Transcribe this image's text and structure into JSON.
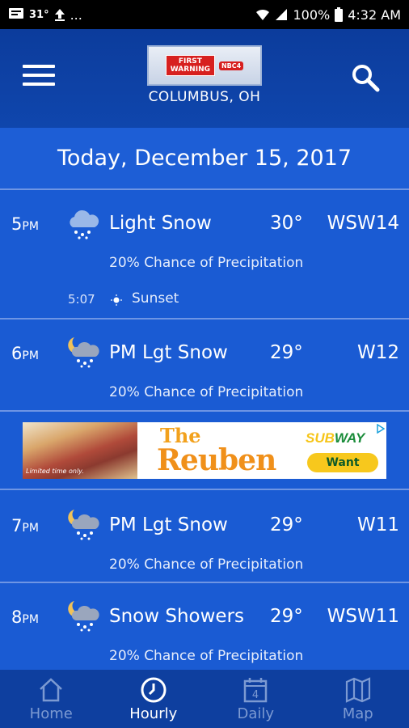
{
  "status_bar": {
    "temp": "31°",
    "overflow": "...",
    "battery": "100%",
    "time": "4:32 AM"
  },
  "header": {
    "logo_line1": "FIRST",
    "logo_line2": "WARNING",
    "location": "COLUMBUS, OH"
  },
  "date_label": "Today, December 15, 2017",
  "hours": [
    {
      "hour": "5",
      "period": "PM",
      "condition": "Light Snow",
      "temp": "30°",
      "wind": "WSW14",
      "precip": "20% Chance of Precipitation",
      "icon": "snow-cloud-icon"
    },
    {
      "hour": "6",
      "period": "PM",
      "condition": "PM Lgt Snow",
      "temp": "29°",
      "wind": "W12",
      "precip": "20% Chance of Precipitation",
      "icon": "night-snow-icon"
    },
    {
      "hour": "7",
      "period": "PM",
      "condition": "PM Lgt Snow",
      "temp": "29°",
      "wind": "W11",
      "precip": "20% Chance of Precipitation",
      "icon": "night-snow-icon"
    },
    {
      "hour": "8",
      "period": "PM",
      "condition": "Snow Showers",
      "temp": "29°",
      "wind": "WSW11",
      "precip": "20% Chance of Precipitation",
      "icon": "night-snow-icon"
    }
  ],
  "sunset": {
    "time": "5:07",
    "label": "Sunset"
  },
  "ad": {
    "the": "The",
    "name": "Reuben",
    "brand_a": "SUB",
    "brand_b": "WAY",
    "cta": "Want",
    "fine_print": "Limited time only."
  },
  "nav": [
    {
      "label": "Home",
      "icon": "home-icon"
    },
    {
      "label": "Hourly",
      "icon": "clock-icon",
      "active": true
    },
    {
      "label": "Daily",
      "icon": "calendar-icon",
      "calendar_day": "4"
    },
    {
      "label": "Map",
      "icon": "map-icon"
    }
  ]
}
